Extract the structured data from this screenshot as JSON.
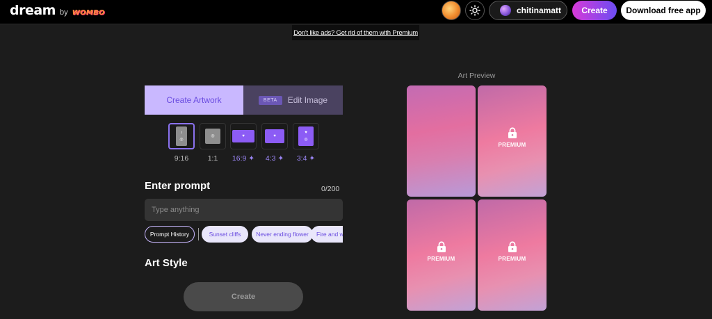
{
  "header": {
    "logo_text": "dream",
    "logo_by": "by",
    "logo_brand": "WOMBO",
    "user_name": "chitinamatt",
    "create_label": "Create",
    "download_label": "Download free app"
  },
  "ad_banner": {
    "text": "Don't like ads? Get rid of them with Premium"
  },
  "tabs": {
    "create": "Create Artwork",
    "edit": "Edit Image",
    "beta_badge": "BETA"
  },
  "aspect_ratios": [
    {
      "label": "9:16",
      "premium": false,
      "selected": true
    },
    {
      "label": "1:1",
      "premium": false,
      "selected": false
    },
    {
      "label": "16:9 ✦",
      "premium": true,
      "selected": false
    },
    {
      "label": "4:3 ✦",
      "premium": true,
      "selected": false
    },
    {
      "label": "3:4 ✦",
      "premium": true,
      "selected": false
    }
  ],
  "prompt": {
    "heading": "Enter prompt",
    "counter": "0/200",
    "placeholder": "Type anything",
    "value": ""
  },
  "chips": {
    "history": "Prompt History",
    "suggestions": [
      "Sunset cliffs",
      "Never ending flower",
      "Fire and water"
    ]
  },
  "art_style": {
    "heading": "Art Style"
  },
  "create_button": "Create",
  "preview": {
    "title": "Art Preview",
    "premium_label": "PREMIUM"
  },
  "colors": {
    "accent": "#8b72f0",
    "tab_active_bg": "#c9b8ff",
    "create_gradient_start": "#d63ad8",
    "create_gradient_end": "#6c4cf2"
  }
}
